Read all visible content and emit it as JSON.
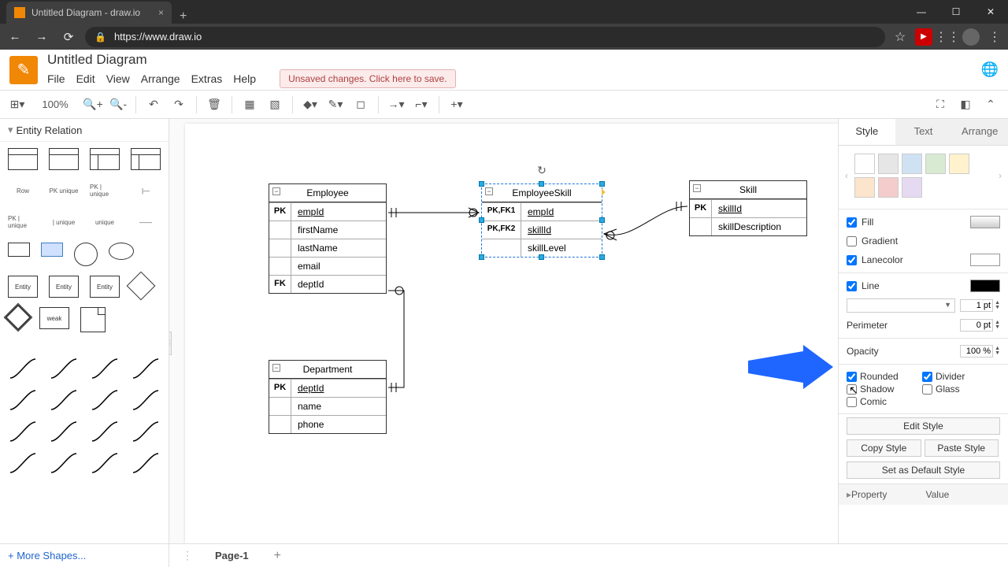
{
  "browser": {
    "tab_title": "Untitled Diagram - draw.io",
    "url": "https://www.draw.io"
  },
  "app": {
    "doc_title": "Untitled Diagram",
    "menu": {
      "file": "File",
      "edit": "Edit",
      "view": "View",
      "arrange": "Arrange",
      "extras": "Extras",
      "help": "Help"
    },
    "save_banner": "Unsaved changes. Click here to save."
  },
  "toolbar": {
    "zoom": "100%"
  },
  "sidebar": {
    "palette_title": "Entity Relation",
    "row_label": "Row",
    "more_shapes": "+ More Shapes..."
  },
  "canvas": {
    "employee": {
      "title": "Employee",
      "rows": [
        {
          "k": "PK",
          "v": "empId"
        },
        {
          "k": "",
          "v": "firstName"
        },
        {
          "k": "",
          "v": "lastName"
        },
        {
          "k": "",
          "v": "email"
        },
        {
          "k": "FK",
          "v": "deptId"
        }
      ]
    },
    "employeeskill": {
      "title": "EmployeeSkill",
      "rows": [
        {
          "k": "PK,FK1",
          "v": "empId"
        },
        {
          "k": "PK,FK2",
          "v": "skillId"
        },
        {
          "k": "",
          "v": "skillLevel"
        }
      ]
    },
    "skill": {
      "title": "Skill",
      "rows": [
        {
          "k": "PK",
          "v": "skillId"
        },
        {
          "k": "",
          "v": "skillDescription"
        }
      ]
    },
    "department": {
      "title": "Department",
      "rows": [
        {
          "k": "PK",
          "v": "deptId"
        },
        {
          "k": "",
          "v": "name"
        },
        {
          "k": "",
          "v": "phone"
        }
      ]
    }
  },
  "format": {
    "tabs": {
      "style": "Style",
      "text": "Text",
      "arrange": "Arrange"
    },
    "swatches": [
      "#ffffff",
      "#e6e6e6",
      "#cfe2f3",
      "#d9ead3",
      "#fff2cc",
      "#fce5cd",
      "#f4cccc",
      "#e6d9f2"
    ],
    "fill": "Fill",
    "gradient": "Gradient",
    "lanecolor": "Lanecolor",
    "line": "Line",
    "line_weight": "1 pt",
    "perimeter": "Perimeter",
    "perimeter_val": "0 pt",
    "opacity": "Opacity",
    "opacity_val": "100 %",
    "rounded": "Rounded",
    "divider": "Divider",
    "shadow": "Shadow",
    "glass": "Glass",
    "comic": "Comic",
    "edit_style": "Edit Style",
    "copy_style": "Copy Style",
    "paste_style": "Paste Style",
    "set_default": "Set as Default Style",
    "property": "Property",
    "value": "Value"
  },
  "footer": {
    "page": "Page-1"
  }
}
